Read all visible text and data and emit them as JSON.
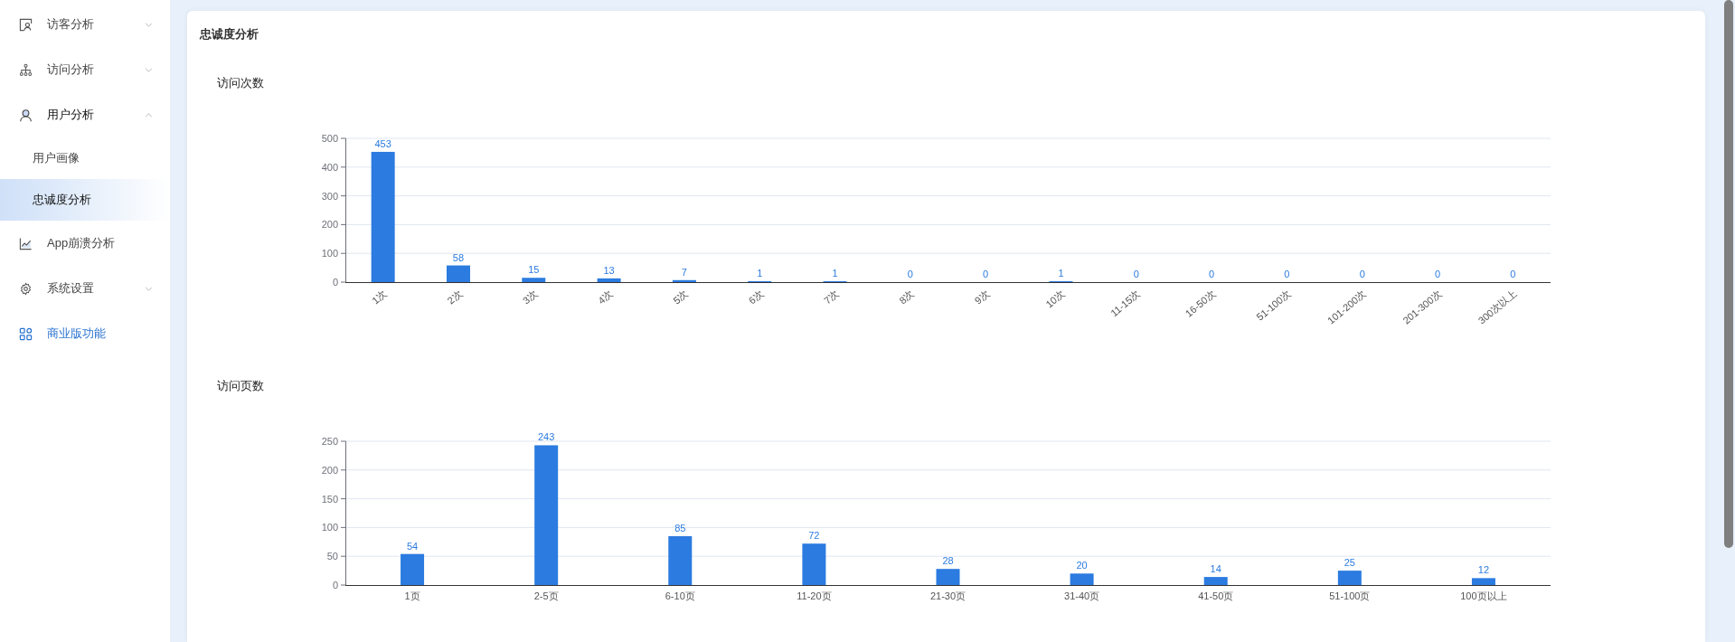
{
  "sidebar": {
    "items": [
      {
        "label": "访客分析",
        "kind": "group",
        "expanded": false,
        "selected": false
      },
      {
        "label": "访问分析",
        "kind": "group",
        "expanded": false,
        "selected": false
      },
      {
        "label": "用户分析",
        "kind": "group",
        "expanded": true,
        "selected": false,
        "children": [
          {
            "label": "用户画像",
            "selected": false
          },
          {
            "label": "忠诚度分析",
            "selected": true
          }
        ]
      },
      {
        "label": "App崩溃分析",
        "kind": "link",
        "selected": false
      },
      {
        "label": "系统设置",
        "kind": "group",
        "expanded": false,
        "selected": false
      },
      {
        "label": "商业版功能",
        "kind": "promo",
        "selected": false
      }
    ]
  },
  "page": {
    "title": "忠诚度分析",
    "charts": [
      {
        "chart_data": {
          "type": "bar",
          "title": "访问次数",
          "categories": [
            "1次",
            "2次",
            "3次",
            "4次",
            "5次",
            "6次",
            "7次",
            "8次",
            "9次",
            "10次",
            "11-15次",
            "16-50次",
            "51-100次",
            "101-200次",
            "201-300次",
            "300次以上"
          ],
          "series": [
            {
              "color": "#2b7be0",
              "values": [
                453,
                58,
                15,
                13,
                7,
                1,
                1,
                0,
                0,
                1,
                0,
                0,
                0,
                0,
                0,
                0
              ]
            }
          ],
          "ylim": [
            0,
            500
          ],
          "yticks": [
            0,
            100,
            200,
            300,
            400,
            500
          ],
          "grid": true,
          "data_labels": true
        }
      },
      {
        "chart_data": {
          "type": "bar",
          "title": "访问页数",
          "categories": [
            "1页",
            "2-5页",
            "6-10页",
            "11-20页",
            "21-30页",
            "31-40页",
            "41-50页",
            "51-100页",
            "100页以上"
          ],
          "series": [
            {
              "color": "#2b7be0",
              "values": [
                54,
                243,
                85,
                72,
                28,
                20,
                14,
                25,
                12
              ]
            }
          ],
          "ylim": [
            0,
            250
          ],
          "yticks": [
            0,
            50,
            100,
            150,
            200,
            250
          ],
          "grid": true,
          "data_labels": true
        }
      }
    ]
  }
}
